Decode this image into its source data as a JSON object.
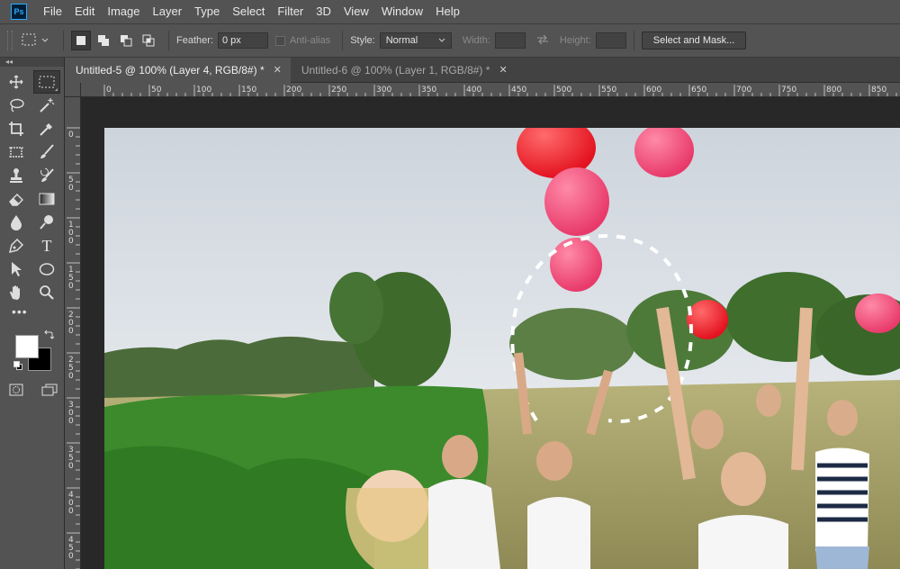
{
  "app": {
    "logo": "Ps"
  },
  "menu": [
    "File",
    "Edit",
    "Image",
    "Layer",
    "Type",
    "Select",
    "Filter",
    "3D",
    "View",
    "Window",
    "Help"
  ],
  "options": {
    "feather_label": "Feather:",
    "feather_value": "0 px",
    "antialias_label": "Anti-alias",
    "style_label": "Style:",
    "style_value": "Normal",
    "width_label": "Width:",
    "height_label": "Height:",
    "select_mask_label": "Select and Mask..."
  },
  "tabs": [
    {
      "label": "Untitled-5 @ 100% (Layer 4, RGB/8#) *",
      "active": true
    },
    {
      "label": "Untitled-6 @ 100% (Layer 1, RGB/8#) *",
      "active": false
    }
  ],
  "tools": [
    "move-tool",
    "rectangular-marquee-tool",
    "lasso-tool",
    "magic-wand-tool",
    "crop-tool",
    "eyedropper-tool",
    "frame-tool",
    "brush-tool",
    "clone-stamp-tool",
    "history-brush-tool",
    "eraser-tool",
    "gradient-tool",
    "blur-tool",
    "dodge-tool",
    "pen-tool",
    "type-tool",
    "path-selection-tool",
    "ellipse-tool",
    "hand-tool",
    "zoom-tool"
  ],
  "type_tool_glyph": "T",
  "more_tools": "•••",
  "colors": {
    "foreground": "#ffffff",
    "background": "#000000"
  },
  "ruler": {
    "h_ticks": [
      "0",
      "50",
      "100",
      "150",
      "200",
      "250",
      "300",
      "350",
      "400",
      "450",
      "500",
      "550",
      "600",
      "650",
      "700",
      "750",
      "800",
      "850"
    ],
    "v_ticks": [
      "0",
      "50",
      "100",
      "150",
      "200",
      "250",
      "300",
      "350",
      "400",
      "450"
    ]
  }
}
